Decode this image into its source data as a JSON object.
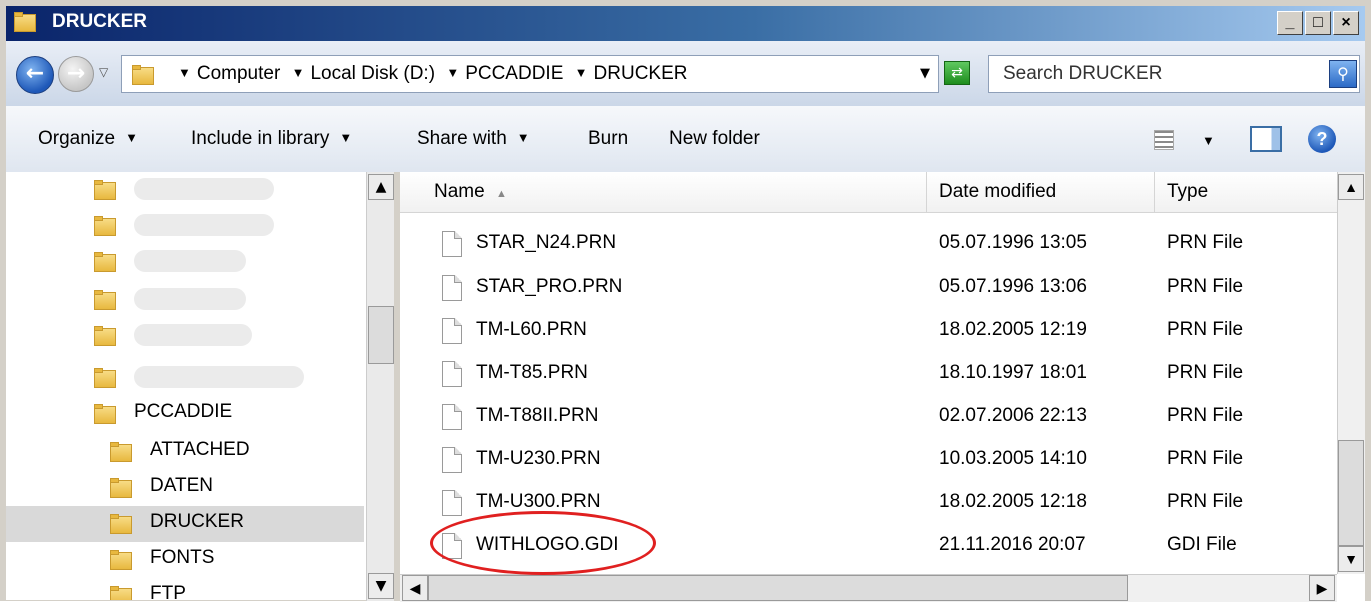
{
  "window": {
    "title": "DRUCKER"
  },
  "title_buttons": {
    "minimize": "_",
    "maximize": "□",
    "close": "×"
  },
  "address": {
    "breadcrumbs": [
      "Computer",
      "Local Disk (D:)",
      "PCCADDIE",
      "DRUCKER"
    ],
    "search_placeholder": "Search DRUCKER"
  },
  "toolbar": {
    "organize": "Organize",
    "include_in_library": "Include in library",
    "share_with": "Share with",
    "burn": "Burn",
    "new_folder": "New folder"
  },
  "nav_tree": {
    "items": [
      {
        "label": "",
        "blurred": true
      },
      {
        "label": "",
        "blurred": true
      },
      {
        "label": "",
        "blurred": true
      },
      {
        "label": "",
        "blurred": true
      },
      {
        "label": "",
        "blurred": true
      },
      {
        "label": "",
        "blurred": true
      },
      {
        "label": "PCCADDIE"
      },
      {
        "label": "ATTACHED"
      },
      {
        "label": "DATEN"
      },
      {
        "label": "DRUCKER",
        "selected": true
      },
      {
        "label": "FONTS"
      },
      {
        "label": "FTP"
      }
    ]
  },
  "columns": {
    "name": "Name",
    "date": "Date modified",
    "type": "Type"
  },
  "files": [
    {
      "name": "STAR_N24.PRN",
      "date": "05.07.1996 13:05",
      "type": "PRN File"
    },
    {
      "name": "STAR_PRO.PRN",
      "date": "05.07.1996 13:06",
      "type": "PRN File"
    },
    {
      "name": "TM-L60.PRN",
      "date": "18.02.2005 12:19",
      "type": "PRN File"
    },
    {
      "name": "TM-T85.PRN",
      "date": "18.10.1997 18:01",
      "type": "PRN File"
    },
    {
      "name": "TM-T88II.PRN",
      "date": "02.07.2006 22:13",
      "type": "PRN File"
    },
    {
      "name": "TM-U230.PRN",
      "date": "10.03.2005 14:10",
      "type": "PRN File"
    },
    {
      "name": "TM-U300.PRN",
      "date": "18.02.2005 12:18",
      "type": "PRN File"
    },
    {
      "name": "WITHLOGO.GDI",
      "date": "21.11.2016 20:07",
      "type": "GDI File"
    }
  ],
  "annotation_color": "#e02020"
}
